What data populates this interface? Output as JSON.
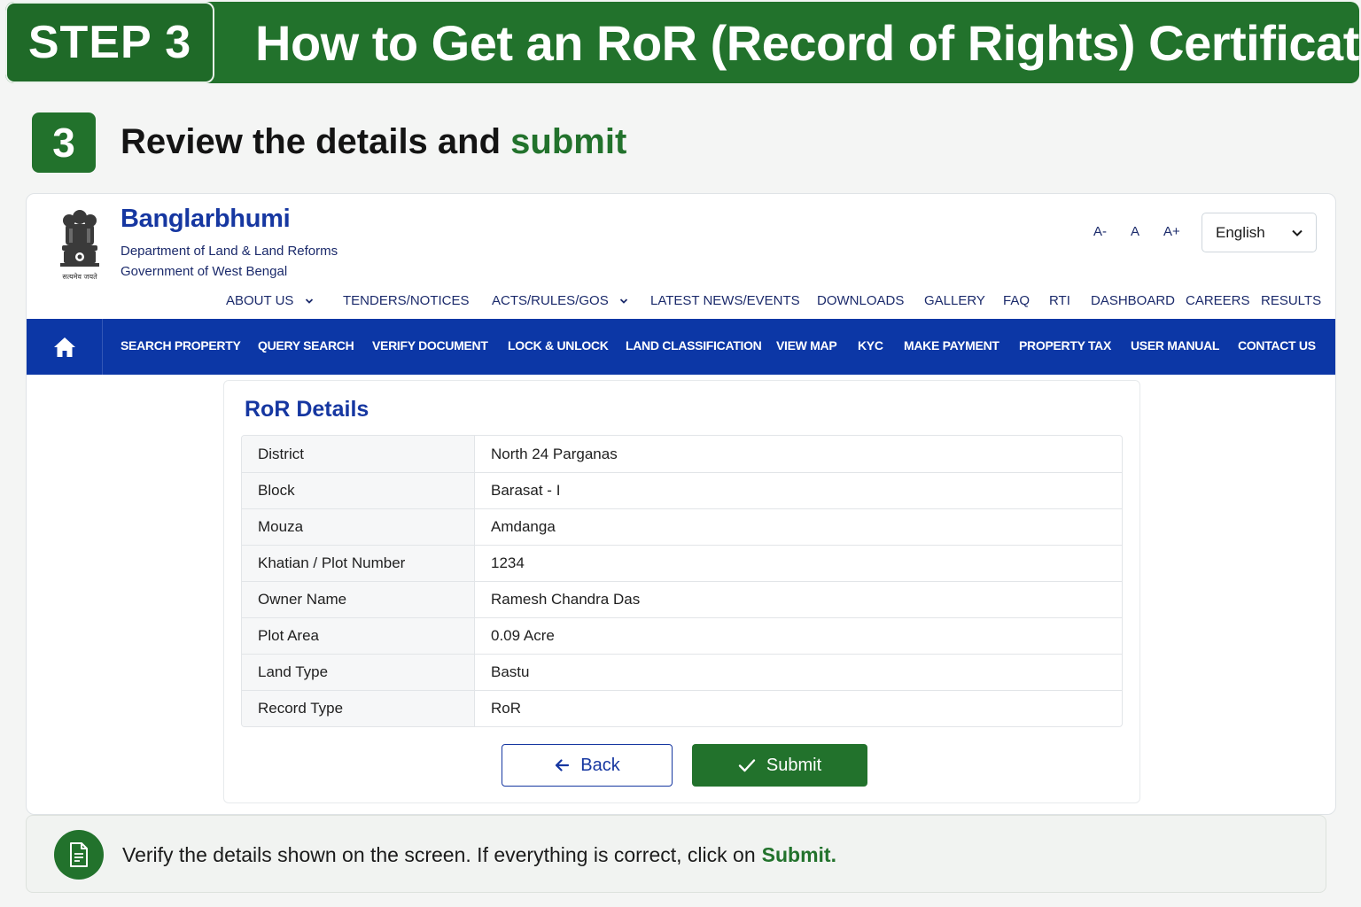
{
  "banner": {
    "step_label": "STEP 3",
    "title": "How to Get an RoR (Record of Rights) Certificate"
  },
  "step": {
    "number": "3",
    "heading_prefix": "Review the details and",
    "heading_accent": "submit"
  },
  "site": {
    "emblem_caption": "सत्यमेव जयते",
    "brand": "Banglarbhumi",
    "department": "Department of Land & Land Reforms",
    "government": "Government of West Bengal",
    "font_controls": [
      "A-",
      "A",
      "A+"
    ],
    "language": "English",
    "top_nav": [
      {
        "label": "ABOUT US",
        "dropdown": true
      },
      {
        "label": "TENDERS/NOTICES",
        "dropdown": false
      },
      {
        "label": "ACTS/RULES/GOS",
        "dropdown": true
      },
      {
        "label": "LATEST NEWS/EVENTS",
        "dropdown": false
      },
      {
        "label": "DOWNLOADS",
        "dropdown": false
      },
      {
        "label": "GALLERY",
        "dropdown": false
      },
      {
        "label": "FAQ",
        "dropdown": false
      },
      {
        "label": "RTI",
        "dropdown": false
      },
      {
        "label": "DASHBOARD",
        "dropdown": false
      },
      {
        "label": "CAREERS",
        "dropdown": false
      },
      {
        "label": "RESULTS",
        "dropdown": false
      }
    ],
    "main_nav": [
      "SEARCH PROPERTY",
      "QUERY SEARCH",
      "VERIFY DOCUMENT",
      "LOCK & UNLOCK",
      "LAND CLASSIFICATION",
      "VIEW MAP",
      "KYC",
      "MAKE PAYMENT",
      "PROPERTY TAX",
      "USER MANUAL",
      "CONTACT US"
    ],
    "home_icon": "home-icon"
  },
  "ror": {
    "title": "RoR Details",
    "rows": [
      {
        "label": "District",
        "value": "North 24 Parganas"
      },
      {
        "label": "Block",
        "value": "Barasat - I"
      },
      {
        "label": "Mouza",
        "value": "Amdanga"
      },
      {
        "label": "Khatian / Plot Number",
        "value": "1234"
      },
      {
        "label": "Owner Name",
        "value": "Ramesh Chandra Das"
      },
      {
        "label": "Plot Area",
        "value": "0.09 Acre"
      },
      {
        "label": "Land Type",
        "value": "Bastu"
      },
      {
        "label": "Record Type",
        "value": "RoR"
      }
    ],
    "back_label": "Back",
    "submit_label": "Submit"
  },
  "tip": {
    "text": "Verify the details shown on the screen. If everything is correct, click on",
    "accent": "Submit."
  },
  "colors": {
    "green": "#22722c",
    "brand_blue": "#1637a1",
    "nav_blue": "#0c37a6"
  }
}
